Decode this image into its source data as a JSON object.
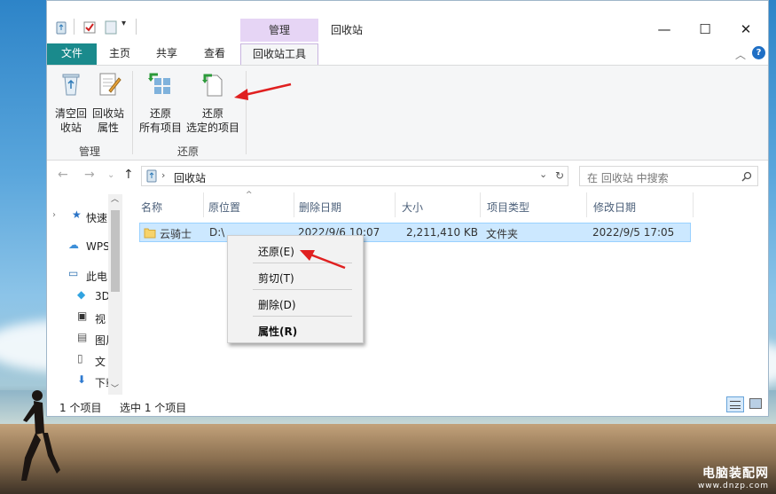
{
  "window": {
    "title": "回收站",
    "context_tab_header": "管理",
    "controls": {
      "minimize": "—",
      "maximize": "☐",
      "close": "✕"
    }
  },
  "tabs": {
    "file": "文件",
    "home": "主页",
    "share": "共享",
    "view": "查看",
    "tools": "回收站工具"
  },
  "ribbon": {
    "manage": {
      "empty_label_1": "清空回",
      "empty_label_2": "收站",
      "props_label_1": "回收站",
      "props_label_2": "属性",
      "group": "管理"
    },
    "restore": {
      "all_label_1": "还原",
      "all_label_2": "所有项目",
      "sel_label_1": "还原",
      "sel_label_2": "选定的项目",
      "group": "还原"
    }
  },
  "address": {
    "path": "回收站",
    "search_placeholder": "在 回收站 中搜索"
  },
  "navpane": {
    "items": [
      "快速",
      "WPS",
      "此电",
      "3D",
      "视",
      "图片",
      "文",
      "下载"
    ]
  },
  "columns": [
    "名称",
    "原位置",
    "删除日期",
    "大小",
    "项目类型",
    "修改日期"
  ],
  "rows": [
    {
      "name": "云骑士",
      "original_location": "D:\\",
      "deleted": "2022/9/6 10:07",
      "size": "2,211,410 KB",
      "type": "文件夹",
      "modified": "2022/9/5 17:05"
    }
  ],
  "status": {
    "count": "1 个项目",
    "selected": "选中 1 个项目"
  },
  "context_menu": {
    "restore": "还原(E)",
    "cut": "剪切(T)",
    "delete": "删除(D)",
    "properties": "属性(R)"
  },
  "watermark": {
    "name": "电脑装配网",
    "url": "www.dnzp.com"
  },
  "colors": {
    "file_tab": "#1a8a8c",
    "context_tab": "#e6d5f5",
    "selection": "#cce8ff",
    "arrow": "#e02020"
  }
}
